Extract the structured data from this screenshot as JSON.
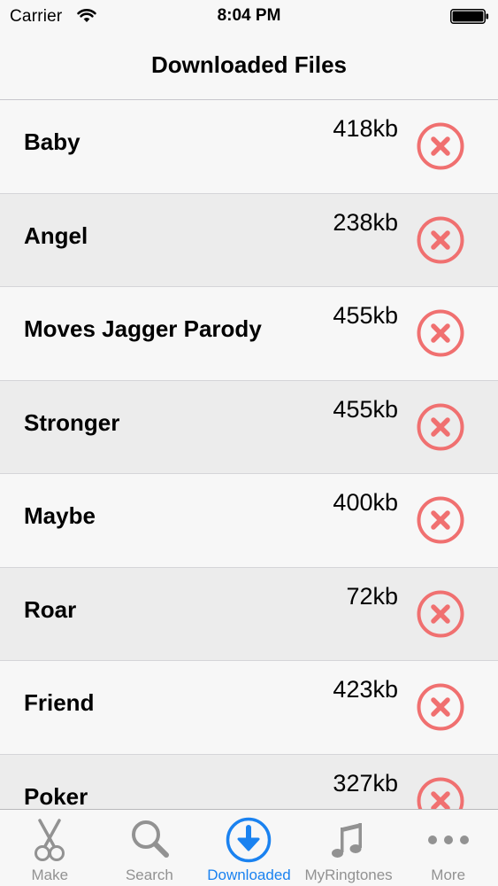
{
  "status_bar": {
    "carrier": "Carrier",
    "time": "8:04 PM"
  },
  "nav": {
    "title": "Downloaded Files"
  },
  "files": [
    {
      "name": "Baby",
      "size": "418kb"
    },
    {
      "name": "Angel",
      "size": "238kb"
    },
    {
      "name": "Moves Jagger Parody",
      "size": "455kb"
    },
    {
      "name": "Stronger",
      "size": "455kb"
    },
    {
      "name": "Maybe",
      "size": "400kb"
    },
    {
      "name": "Roar",
      "size": "72kb"
    },
    {
      "name": "Friend",
      "size": "423kb"
    },
    {
      "name": "Poker",
      "size": "327kb"
    }
  ],
  "tabs": [
    {
      "label": "Make",
      "icon": "scissors-icon",
      "active": false
    },
    {
      "label": "Search",
      "icon": "magnifier-icon",
      "active": false
    },
    {
      "label": "Downloaded",
      "icon": "download-arrow-icon",
      "active": true
    },
    {
      "label": "MyRingtones",
      "icon": "music-note-icon",
      "active": false
    },
    {
      "label": "More",
      "icon": "ellipsis-icon",
      "active": false
    }
  ],
  "colors": {
    "delete_red": "#f07070",
    "active_tab": "#1a82f0",
    "inactive_tab": "#929292"
  }
}
